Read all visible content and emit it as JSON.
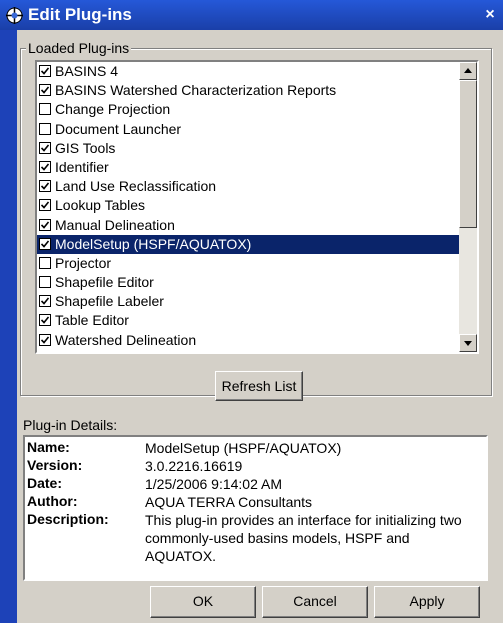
{
  "window": {
    "title": "Edit Plug-ins",
    "close_label": "×"
  },
  "loaded": {
    "legend": "Loaded Plug-ins",
    "items": [
      {
        "label": "BASINS 4",
        "checked": true,
        "selected": false
      },
      {
        "label": "BASINS Watershed Characterization Reports",
        "checked": true,
        "selected": false
      },
      {
        "label": "Change Projection",
        "checked": false,
        "selected": false
      },
      {
        "label": "Document Launcher",
        "checked": false,
        "selected": false
      },
      {
        "label": "GIS Tools",
        "checked": true,
        "selected": false
      },
      {
        "label": "Identifier",
        "checked": true,
        "selected": false
      },
      {
        "label": "Land Use Reclassification",
        "checked": true,
        "selected": false
      },
      {
        "label": "Lookup Tables",
        "checked": true,
        "selected": false
      },
      {
        "label": "Manual Delineation",
        "checked": true,
        "selected": false
      },
      {
        "label": "ModelSetup (HSPF/AQUATOX)",
        "checked": true,
        "selected": true
      },
      {
        "label": "Projector",
        "checked": false,
        "selected": false
      },
      {
        "label": "Shapefile Editor",
        "checked": false,
        "selected": false
      },
      {
        "label": "Shapefile Labeler",
        "checked": true,
        "selected": false
      },
      {
        "label": "Table Editor",
        "checked": true,
        "selected": false
      },
      {
        "label": "Watershed Delineation",
        "checked": true,
        "selected": false
      }
    ],
    "refresh_label": "Refresh List"
  },
  "details": {
    "label": "Plug-in Details:",
    "name_key": "Name:",
    "name": "ModelSetup (HSPF/AQUATOX)",
    "version_key": "Version:",
    "version": "3.0.2216.16619",
    "date_key": "Date:",
    "date": "1/25/2006 9:14:02 AM",
    "author_key": "Author:",
    "author": "AQUA TERRA Consultants",
    "description_key": "Description:",
    "description": "This plug-in provides an interface for initializing two commonly-used basins models, HSPF and AQUATOX."
  },
  "buttons": {
    "ok": "OK",
    "cancel": "Cancel",
    "apply": "Apply"
  },
  "colors": {
    "selection": "#0a246a",
    "dialog": "#d4d0c8",
    "desktop": "#1d42b8"
  }
}
